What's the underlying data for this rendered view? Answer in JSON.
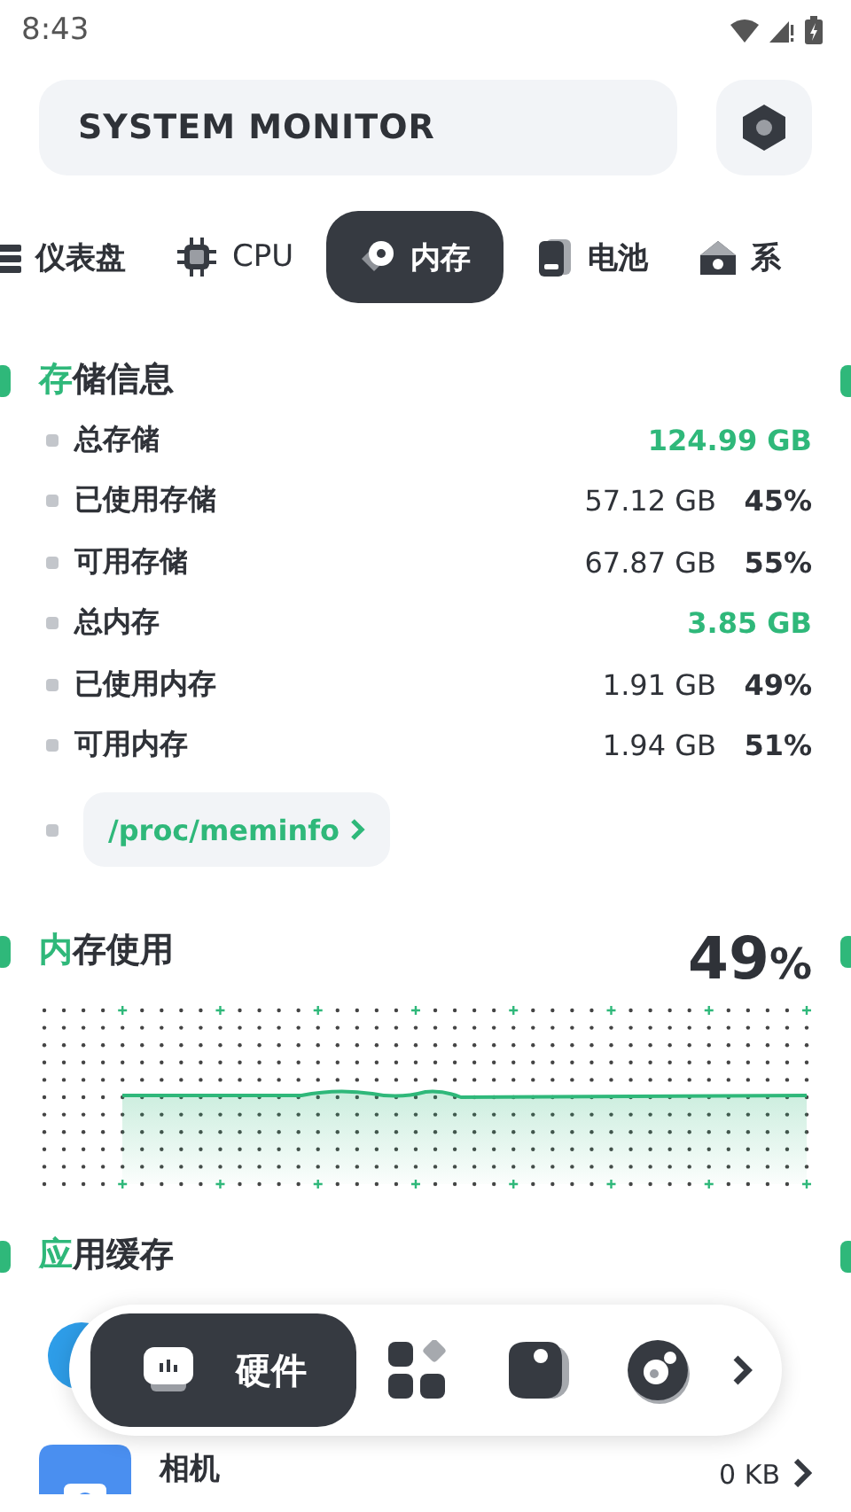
{
  "status_bar": {
    "time": "8:43"
  },
  "header": {
    "title": "SYSTEM MONITOR"
  },
  "tabs": [
    {
      "label": "仪表盘",
      "kind": "dashboard",
      "selected": false
    },
    {
      "label": "CPU",
      "kind": "cpu",
      "selected": false
    },
    {
      "label": "内存",
      "kind": "memory",
      "selected": true
    },
    {
      "label": "电池",
      "kind": "battery",
      "selected": false
    },
    {
      "label": "系",
      "kind": "system",
      "selected": false
    }
  ],
  "storage_info": {
    "title": "存储信息",
    "rows": [
      {
        "label": "总存储",
        "value": "124.99 GB",
        "highlight": true
      },
      {
        "label": "已使用存储",
        "value": "57.12 GB",
        "percent": "45%",
        "highlight": false
      },
      {
        "label": "可用存储",
        "value": "67.87 GB",
        "percent": "55%",
        "highlight": false
      },
      {
        "label": "总内存",
        "value": "3.85 GB",
        "highlight": true
      },
      {
        "label": "已使用内存",
        "value": "1.91 GB",
        "percent": "49%",
        "highlight": false
      },
      {
        "label": "可用内存",
        "value": "1.94 GB",
        "percent": "51%",
        "highlight": false
      }
    ],
    "link": "/proc/meminfo"
  },
  "memory_usage": {
    "title": "内存使用",
    "value": "49",
    "unit": "%"
  },
  "app_cache": {
    "title": "应用缓存",
    "apps": [
      {
        "name": "相机",
        "size": "0 KB"
      }
    ]
  },
  "bottom_nav": [
    {
      "label": "硬件",
      "kind": "hardware",
      "selected": true
    },
    {
      "kind": "apps",
      "selected": false
    },
    {
      "kind": "tag",
      "selected": false
    },
    {
      "kind": "disc",
      "selected": false
    }
  ]
}
